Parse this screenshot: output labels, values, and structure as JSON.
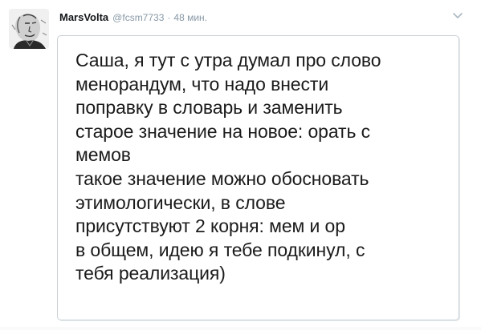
{
  "tweet": {
    "display_name": "MarsVolta",
    "handle": "@fcsm7733",
    "separator": "·",
    "timestamp": "48 мин.",
    "avatar_icon": "avatar-portrait-icon",
    "menu_icon": "chevron-down-icon",
    "note_lines": "Саша, я тут с утра думал про слово\nменорандум, что надо внести\nпоправку в словарь и заменить\nстарое значение на новое: орать с\nмемов\nтакое значение можно обосновать\nэтимологически, в слове\nприсутствуют 2 корня: мем и ор\nв общем, идею я тебе подкинул, с\nтебя реализация)"
  },
  "colors": {
    "name": "#14171a",
    "meta": "#8899a6",
    "card_border": "#c9d0d5",
    "text": "#1b1b1b"
  }
}
